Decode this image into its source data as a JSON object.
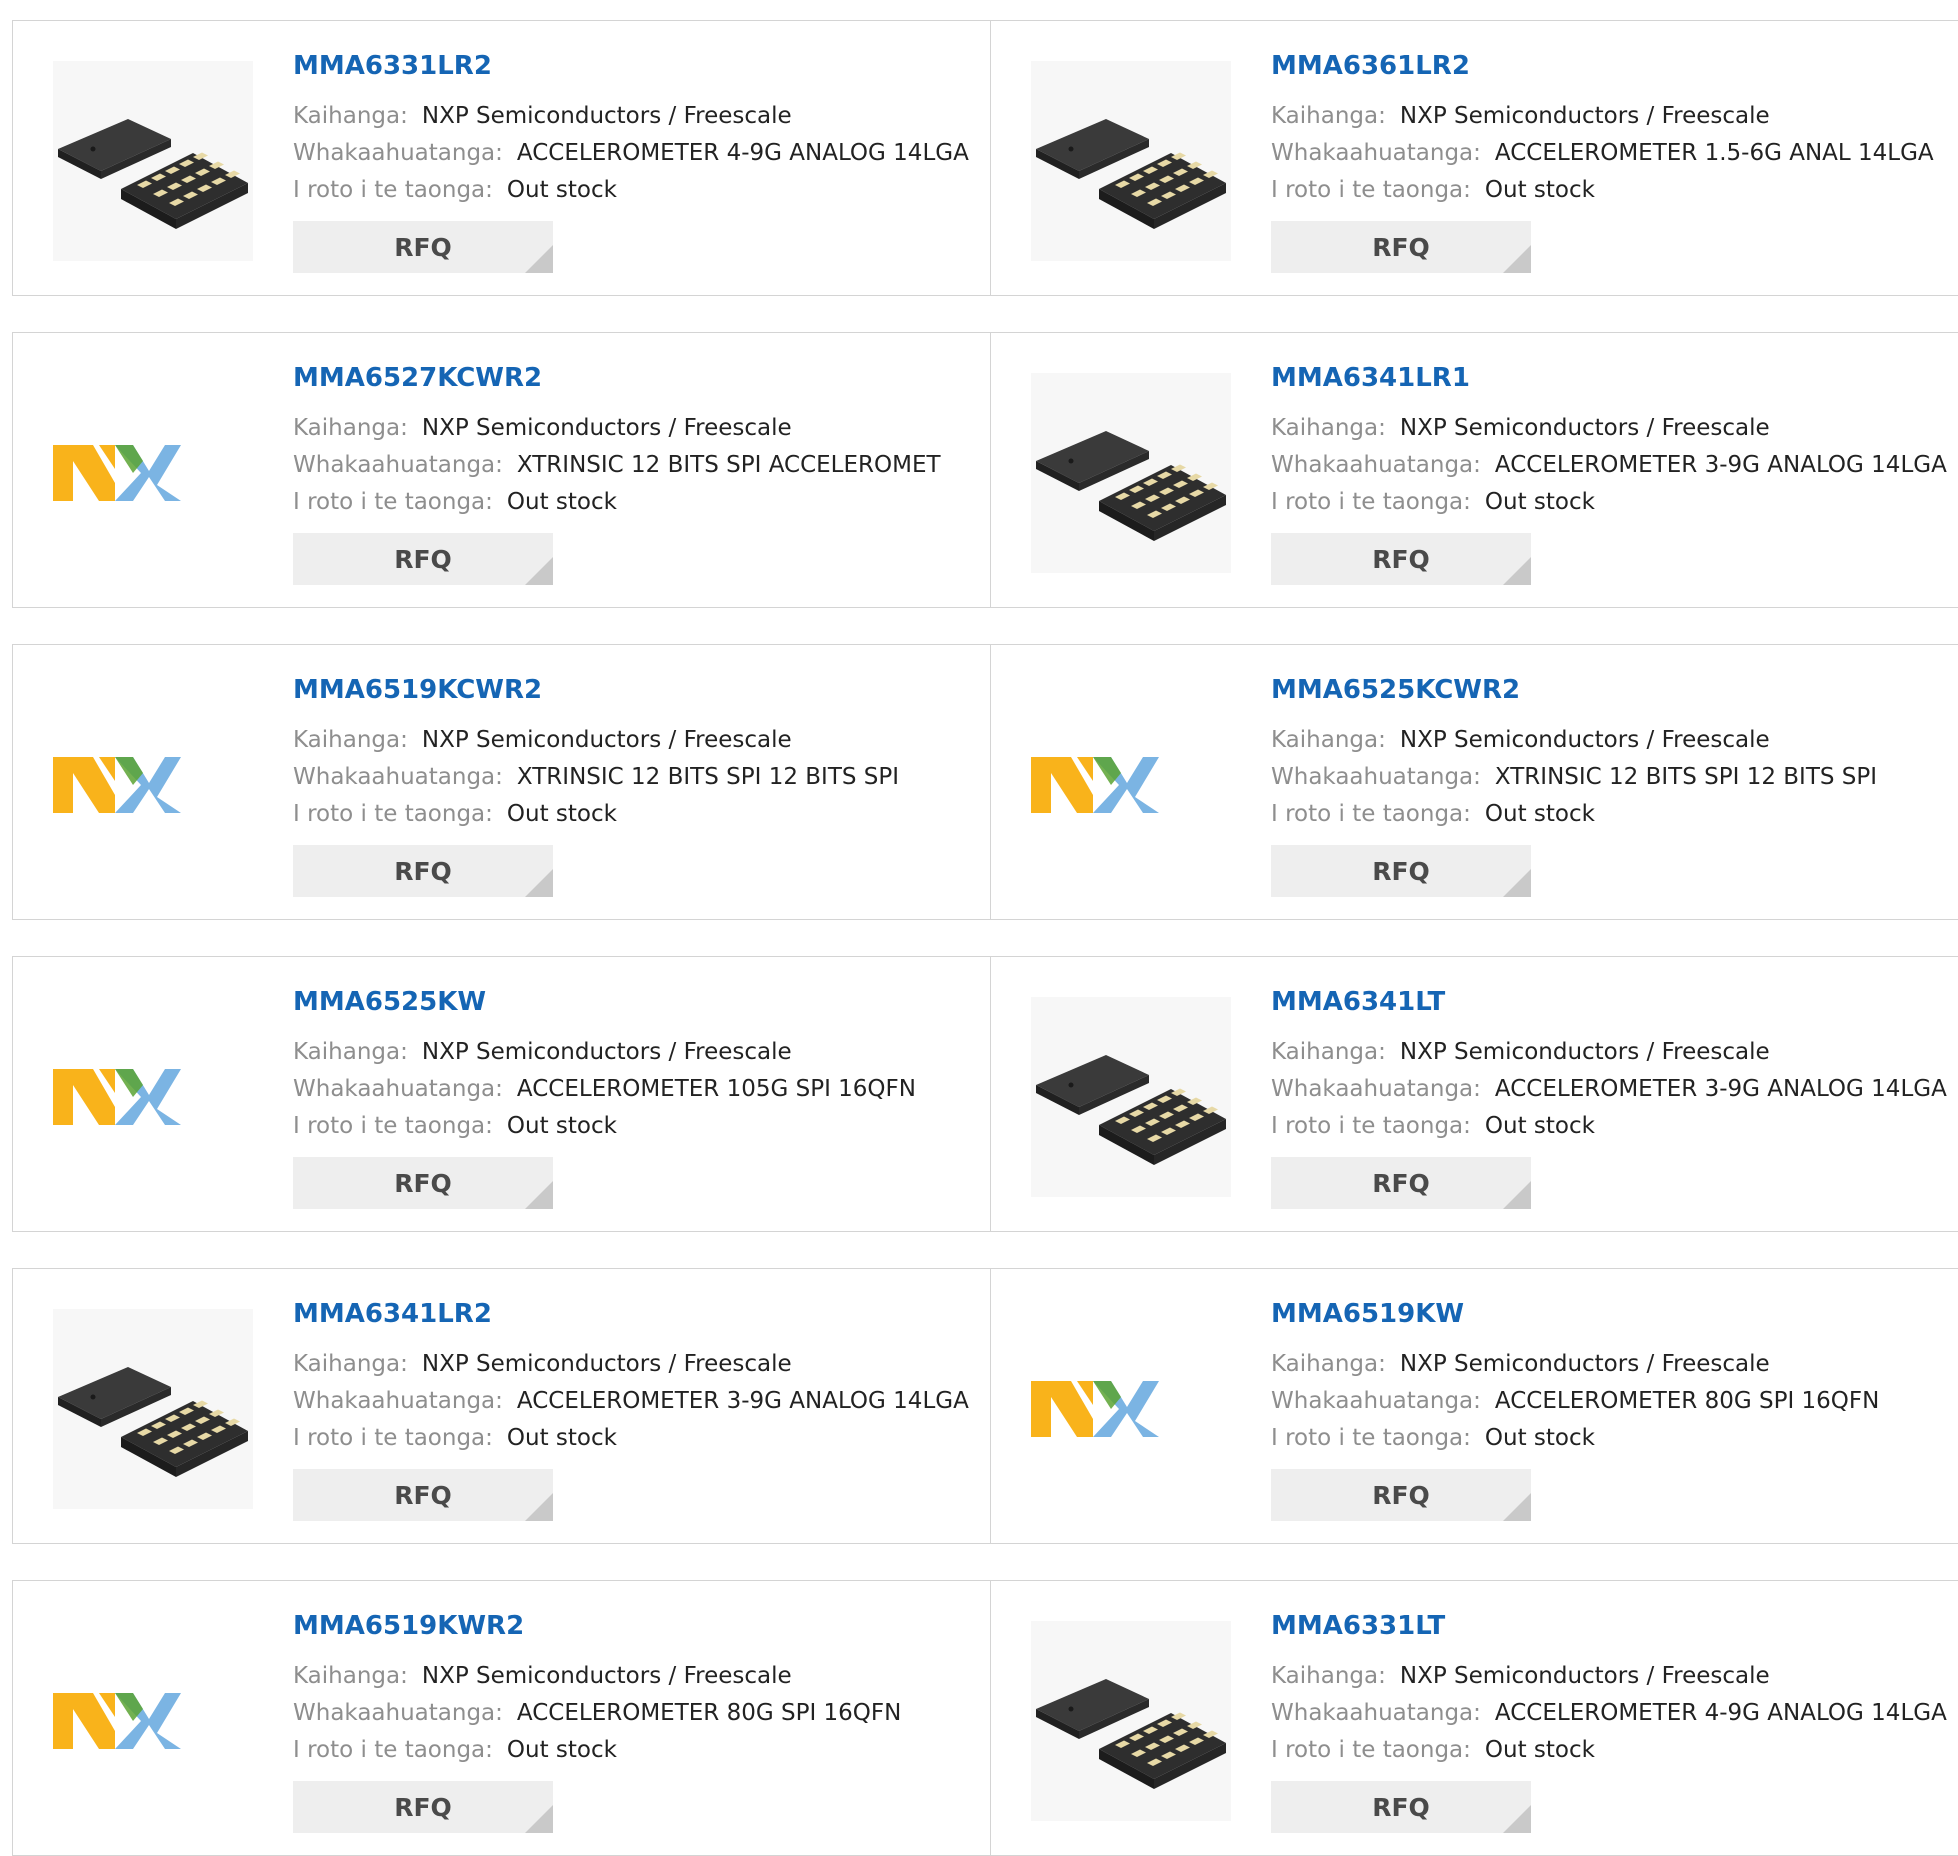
{
  "labels": {
    "manufacturer": "Kaihanga:",
    "description": "Whakaahuatanga:",
    "stock": "I roto i te taonga:",
    "rfq": "RFQ"
  },
  "products": [
    {
      "part": "MMA6331LR2",
      "manufacturer": "NXP Semiconductors / Freescale",
      "description": "ACCELEROMETER 4-9G ANALOG 14LGA",
      "stock": "Out stock",
      "image": "chip-package-icon"
    },
    {
      "part": "MMA6361LR2",
      "manufacturer": "NXP Semiconductors / Freescale",
      "description": "ACCELEROMETER 1.5-6G ANAL 14LGA",
      "stock": "Out stock",
      "image": "chip-package-icon"
    },
    {
      "part": "MMA6527KCWR2",
      "manufacturer": "NXP Semiconductors / Freescale",
      "description": "XTRINSIC 12 BITS SPI ACCELEROMET",
      "stock": "Out stock",
      "image": "nxp-logo"
    },
    {
      "part": "MMA6341LR1",
      "manufacturer": "NXP Semiconductors / Freescale",
      "description": "ACCELEROMETER 3-9G ANALOG 14LGA",
      "stock": "Out stock",
      "image": "chip-package-icon"
    },
    {
      "part": "MMA6519KCWR2",
      "manufacturer": "NXP Semiconductors / Freescale",
      "description": "XTRINSIC 12 BITS SPI 12 BITS SPI",
      "stock": "Out stock",
      "image": "nxp-logo"
    },
    {
      "part": "MMA6525KCWR2",
      "manufacturer": "NXP Semiconductors / Freescale",
      "description": "XTRINSIC 12 BITS SPI 12 BITS SPI",
      "stock": "Out stock",
      "image": "nxp-logo"
    },
    {
      "part": "MMA6525KW",
      "manufacturer": "NXP Semiconductors / Freescale",
      "description": "ACCELEROMETER 105G SPI 16QFN",
      "stock": "Out stock",
      "image": "nxp-logo"
    },
    {
      "part": "MMA6341LT",
      "manufacturer": "NXP Semiconductors / Freescale",
      "description": "ACCELEROMETER 3-9G ANALOG 14LGA",
      "stock": "Out stock",
      "image": "chip-package-icon"
    },
    {
      "part": "MMA6341LR2",
      "manufacturer": "NXP Semiconductors / Freescale",
      "description": "ACCELEROMETER 3-9G ANALOG 14LGA",
      "stock": "Out stock",
      "image": "chip-package-icon"
    },
    {
      "part": "MMA6519KW",
      "manufacturer": "NXP Semiconductors / Freescale",
      "description": "ACCELEROMETER 80G SPI 16QFN",
      "stock": "Out stock",
      "image": "nxp-logo"
    },
    {
      "part": "MMA6519KWR2",
      "manufacturer": "NXP Semiconductors / Freescale",
      "description": "ACCELEROMETER 80G SPI 16QFN",
      "stock": "Out stock",
      "image": "nxp-logo"
    },
    {
      "part": "MMA6331LT",
      "manufacturer": "NXP Semiconductors / Freescale",
      "description": "ACCELEROMETER 4-9G ANALOG 14LGA",
      "stock": "Out stock",
      "image": "chip-package-icon"
    }
  ],
  "colors": {
    "link": "#1565b4",
    "nxp_orange": "#f9b31b",
    "nxp_blue": "#7bb4e3",
    "nxp_green": "#c9d200"
  }
}
